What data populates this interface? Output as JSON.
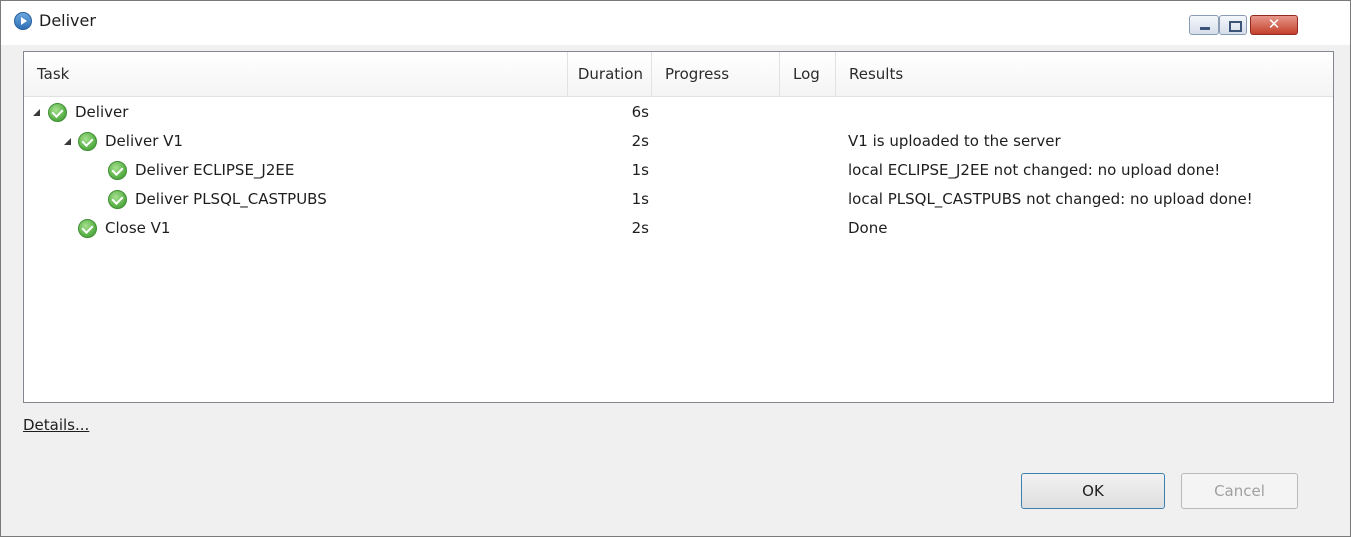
{
  "window": {
    "title": "Deliver"
  },
  "table": {
    "columns": [
      "Task",
      "Duration",
      "Progress",
      "Log",
      "Results"
    ],
    "rows": [
      {
        "task": "Deliver",
        "duration": "6s",
        "result": ""
      },
      {
        "task": "Deliver V1",
        "duration": "2s",
        "result": "V1 is uploaded to the server"
      },
      {
        "task": "Deliver ECLIPSE_J2EE",
        "duration": "1s",
        "result": "local ECLIPSE_J2EE not changed: no upload done!"
      },
      {
        "task": "Deliver PLSQL_CASTPUBS",
        "duration": "1s",
        "result": "local PLSQL_CASTPUBS not changed: no upload done!"
      },
      {
        "task": "Close V1",
        "duration": "2s",
        "result": "Done"
      }
    ]
  },
  "footer": {
    "details_label": "Details...",
    "ok_label": "OK",
    "cancel_label": "Cancel"
  },
  "icons": {
    "status": "green-check-icon",
    "expander": "expanded-triangle-icon"
  },
  "colors": {
    "status_green": "#5cb24a",
    "ok_border": "#3c7fb1",
    "close_red": "#c4402c"
  }
}
